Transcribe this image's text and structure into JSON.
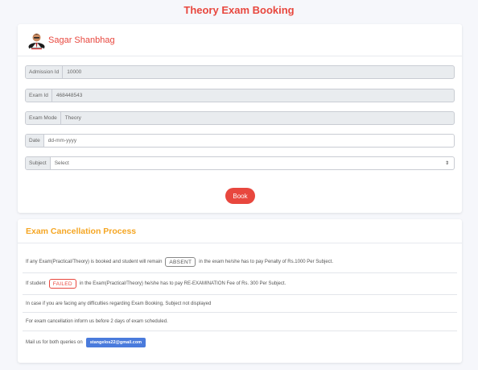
{
  "page": {
    "title": "Theory Exam Booking"
  },
  "profile": {
    "name": "Sagar Shanbhag"
  },
  "form": {
    "admission_label": "Admission Id",
    "admission_value": "10000",
    "exam_id_label": "Exam Id",
    "exam_id_value": "468448543",
    "exam_mode_label": "Exam Mode",
    "exam_mode_value": "Theory",
    "date_label": "Date",
    "date_placeholder": "dd-mm-yyyy",
    "subject_label": "Subject",
    "subject_selected": "Select",
    "book_label": "Book"
  },
  "cancellation": {
    "title": "Exam Cancellation Process",
    "row1_pre": "If any Exam(Practical/Theory) is booked and student will remain",
    "row1_tag": "ABSENT",
    "row1_post": "in the exam he/she has to pay Penalty of Rs.1000 Per Subject.",
    "row2_pre": "If student",
    "row2_tag": "FAILED",
    "row2_post": "in the Exam(Practical/Theory) he/she has to pay RE-EXAMINATION Fee of Rs. 300 Per Subject.",
    "row3": "In case if you are facing any difficulties regarding Exam Booking, Subject not displayed",
    "row4": "For exam cancellation inform us before 2 days of exam scheduled.",
    "row5_pre": "Mail us for both queries on",
    "email": "stangelos22@gmail.com"
  },
  "colors": {
    "accent": "#e8473e",
    "section_title": "#f5a623",
    "email_badge": "#4a7bdc"
  }
}
